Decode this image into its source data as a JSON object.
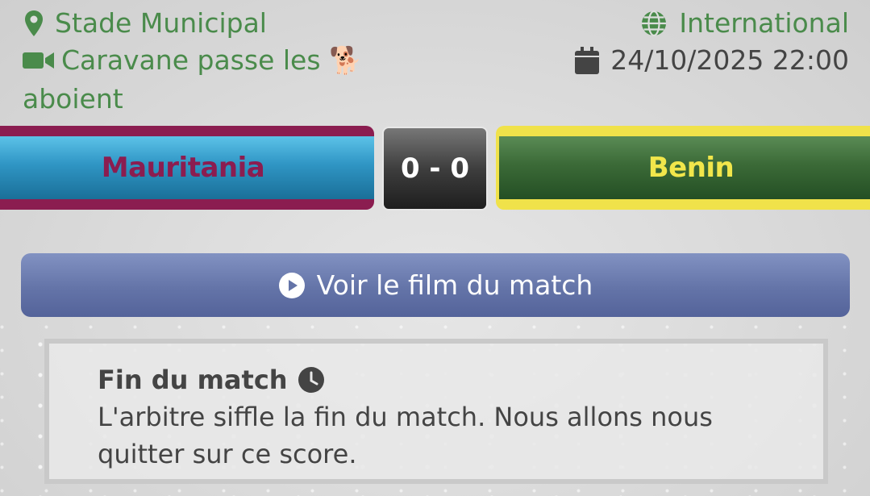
{
  "match_info": {
    "venue": "Stade Municipal",
    "venue_icon": "map-pin-icon",
    "channel": "Caravane passe les 🐕 aboient",
    "channel_icon": "video-camera-icon",
    "competition": "International",
    "competition_icon": "globe-icon",
    "datetime": "24/10/2025 22:00",
    "datetime_icon": "calendar-icon"
  },
  "scoreboard": {
    "home_team": "Mauritania",
    "score": "0 - 0",
    "away_team": "Benin"
  },
  "film_button": {
    "label": "Voir le film du match",
    "icon": "play-circle-icon"
  },
  "event": {
    "title": "Fin du match",
    "title_icon": "clock-icon",
    "text": "L'arbitre siffle la fin du match. Nous allons nous quitter sur ce score."
  },
  "colors": {
    "info_green": "#4a8b4b",
    "home_primary": "#8b1d50",
    "home_secondary": "#2f95c4",
    "away_primary": "#f0e24a",
    "away_secondary": "#3b6a37",
    "button_blue": "#6474a8"
  }
}
